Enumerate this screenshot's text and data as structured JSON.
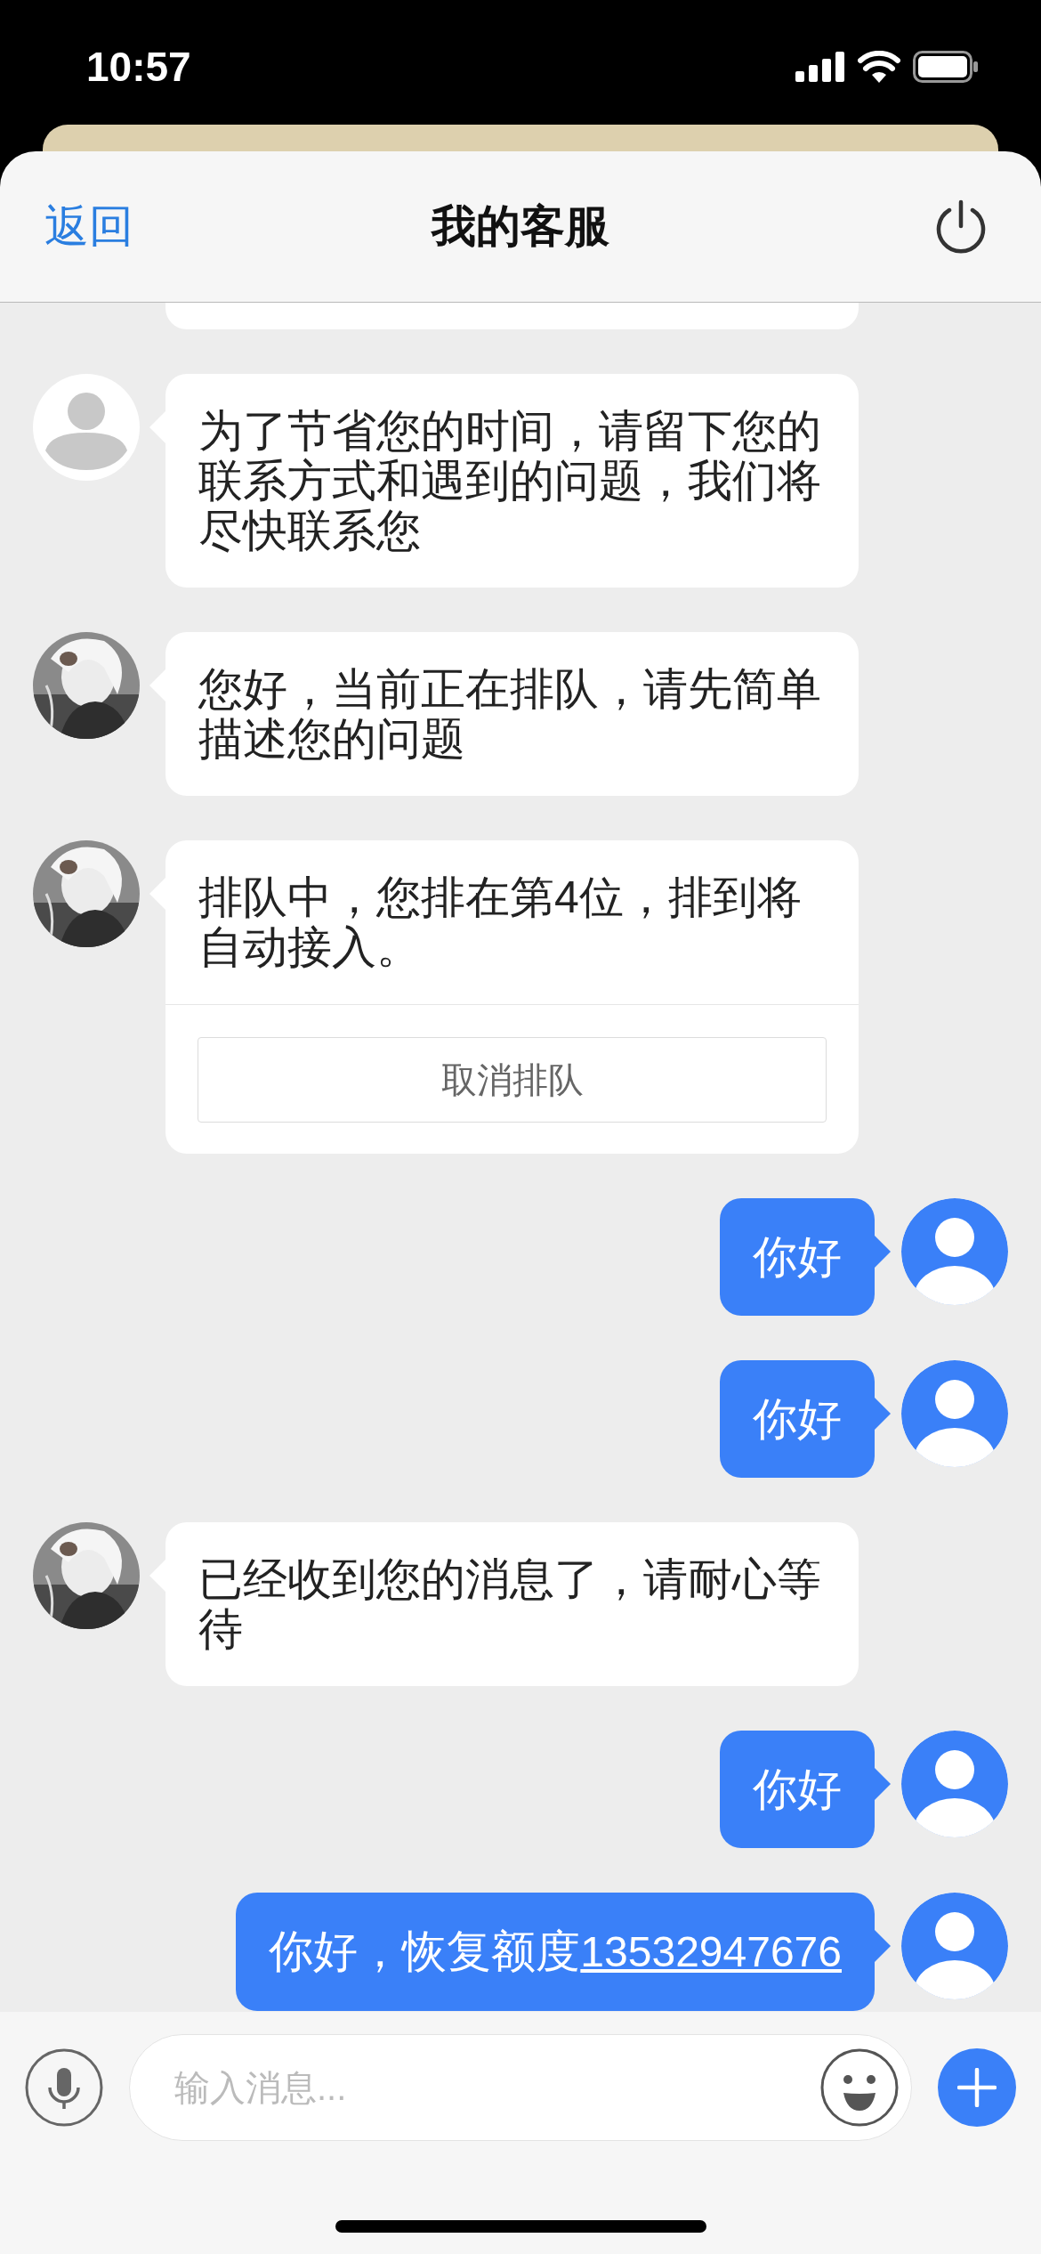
{
  "status_bar": {
    "time": "10:57"
  },
  "nav": {
    "back": "返回",
    "title": "我的客服"
  },
  "messages": [
    {
      "kind": "agent",
      "avatar": {
        "kind": "default"
      },
      "text": "为了节省您的时间，请留下您的联系方式和遇到的问题，我们将尽快联系您"
    },
    {
      "kind": "agent",
      "text": "您好，当前正在排队，请先简单描述您的问题"
    },
    {
      "kind": "agent",
      "text": "排队中，您排在第4位，排到将自动接入。",
      "button": "取消排队"
    },
    {
      "kind": "user",
      "avatar": {
        "kind": "default"
      },
      "text": "你好"
    },
    {
      "kind": "user",
      "avatar": {
        "kind": "default"
      },
      "text": "你好"
    },
    {
      "kind": "agent",
      "text": "已经收到您的消息了，请耐心等待"
    },
    {
      "kind": "user",
      "avatar": {
        "kind": "default"
      },
      "text": "你好"
    },
    {
      "kind": "user",
      "avatar": {
        "kind": "default"
      },
      "text": "你好，恢复额度",
      "link": "13532947676"
    }
  ],
  "input": {
    "placeholder": "输入消息..."
  }
}
